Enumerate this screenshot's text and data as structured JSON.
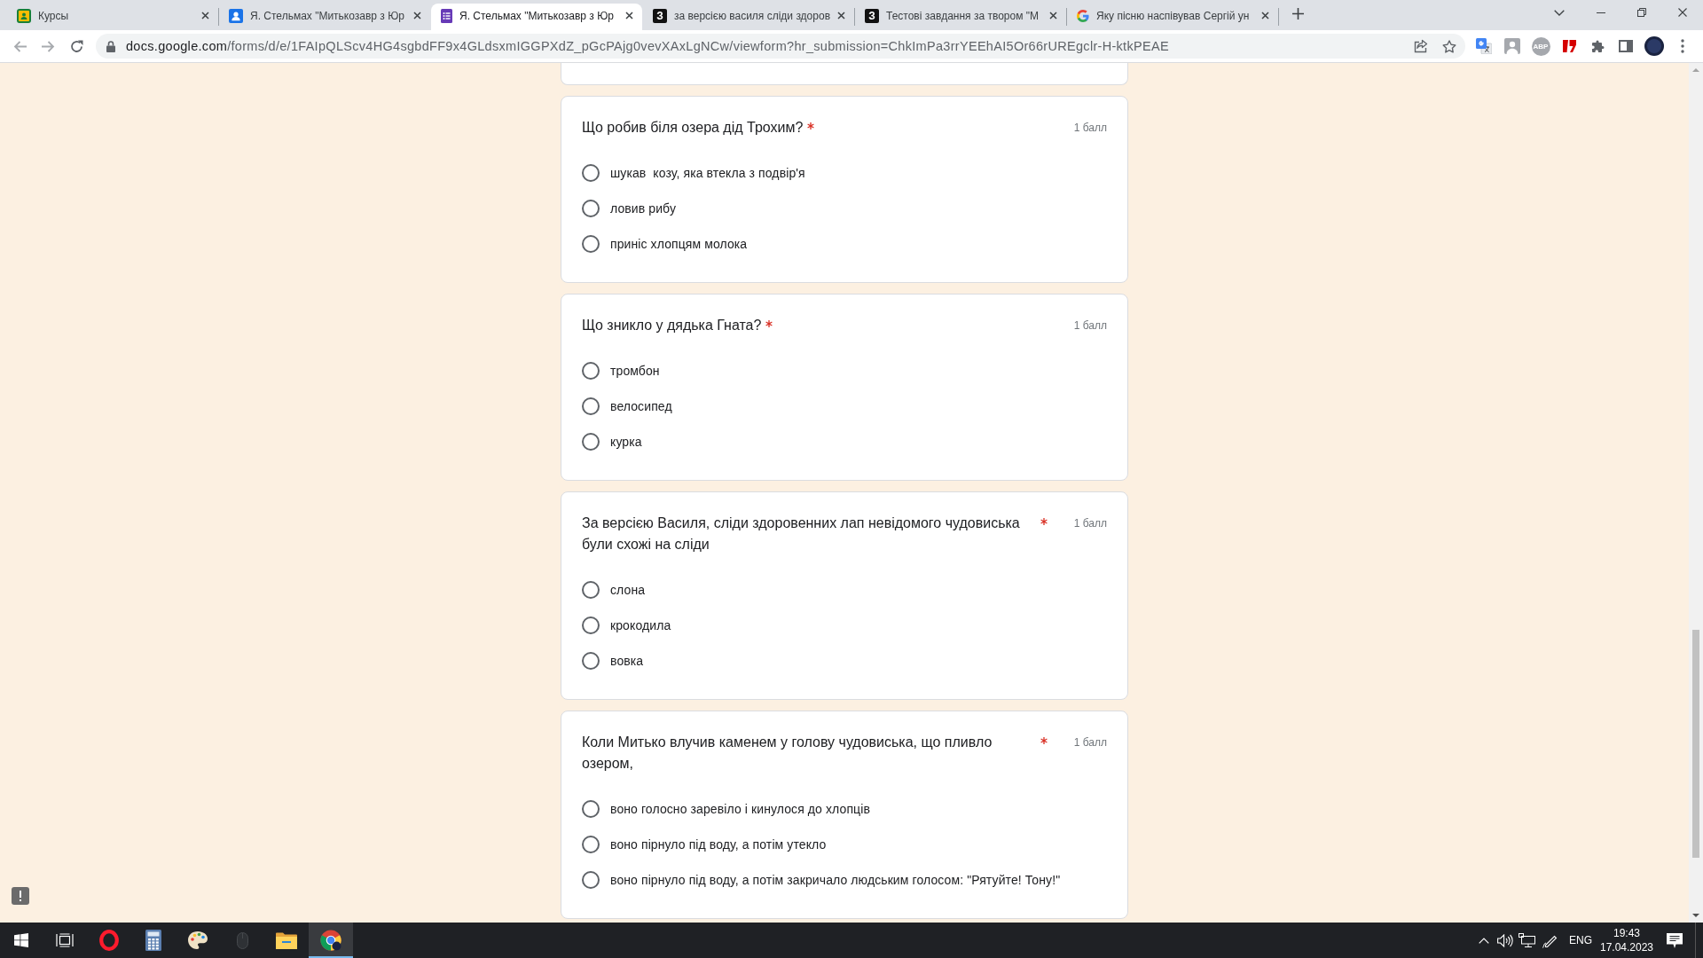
{
  "browser": {
    "tabs": [
      {
        "kind": "board",
        "title": "Курсы",
        "selected": false
      },
      {
        "kind": "person-card",
        "title": "Я. Стельмах \"Митькозавр з Юр",
        "selected": false
      },
      {
        "kind": "form",
        "title": "Я. Стельмах \"Митькозавр з Юр",
        "selected": true
      },
      {
        "kind": "letter-logo",
        "logo_text": "З",
        "title": "за версією василя сліди здоров",
        "selected": false
      },
      {
        "kind": "letter-logo",
        "logo_text": "З",
        "title": "Тестові завдання за твором \"М",
        "selected": false
      },
      {
        "kind": "g-logo",
        "title": "Яку пісню наспівував Сергій ун",
        "selected": false
      }
    ],
    "url": "docs.google.com/forms/d/e/1FAIpQLScv4HG4sgbdFF9x4GLdsxmIGGPXdZ_pGcPAjg0vevXAxLgNCw/viewform?hr_submission=ChkImPa3rrYEEhAI5Or66rUREgclr-H-ktkPEAE",
    "extension_badge": "ABP"
  },
  "form": {
    "questions": [
      {
        "title": "Що робив біля озера дід Трохим?",
        "required": true,
        "points": "1 балл",
        "options": [
          {
            "label": "шукав  козу, яка втекла з подвір'я",
            "selected": false
          },
          {
            "label": "ловив рибу",
            "selected": false
          },
          {
            "label": "приніс хлопцям молока",
            "selected": false
          }
        ]
      },
      {
        "title": "Що зникло у дядька Гната?",
        "required": true,
        "points": "1 балл",
        "options": [
          {
            "label": "тромбон",
            "selected": false
          },
          {
            "label": "велосипед",
            "selected": false
          },
          {
            "label": "курка",
            "selected": false
          }
        ]
      },
      {
        "title": "За версією Василя, сліди здоровенних лап невідомого чудовиська були схожі на сліди",
        "required": true,
        "points": "1 балл",
        "options": [
          {
            "label": "слона",
            "selected": false
          },
          {
            "label": "крокодила",
            "selected": false
          },
          {
            "label": "вовка",
            "selected": false
          }
        ]
      },
      {
        "title": "Коли Митько влучив каменем у голову чудовиська, що пливло озером,",
        "required": true,
        "points": "1 балл",
        "options": [
          {
            "label": "воно голосно заревіло і кинулося до хлопців",
            "selected": false
          },
          {
            "label": "воно пірнуло під воду, а потім утекло",
            "selected": false
          },
          {
            "label": "воно пірнуло під воду, а потім закричало людським голосом: \"Рятуйте! Тону!\"",
            "selected": false
          }
        ]
      }
    ]
  },
  "taskbar": {
    "apps": [
      {
        "kind": "ring-logo",
        "active": false
      },
      {
        "kind": "calculator",
        "active": false
      },
      {
        "kind": "palette",
        "active": false
      },
      {
        "kind": "mouse",
        "active": false
      },
      {
        "kind": "folder",
        "active": false
      },
      {
        "kind": "browser",
        "active": true
      }
    ],
    "language": "ENG",
    "time": "19:43",
    "date": "17.04.2023"
  }
}
